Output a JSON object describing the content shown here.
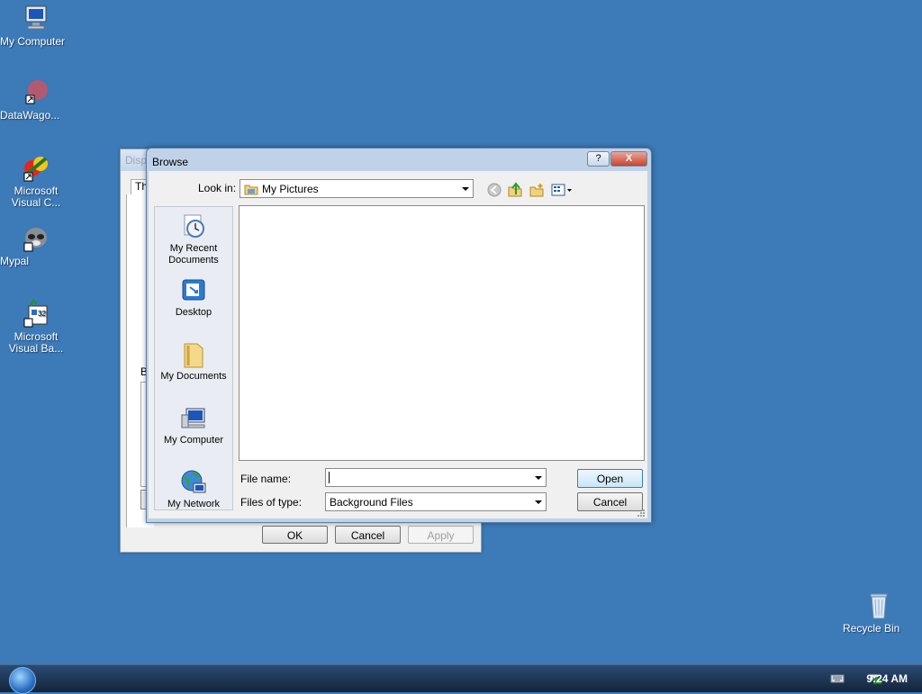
{
  "desktop": {
    "icons": [
      {
        "label": "My Computer",
        "icon": "my-computer-icon"
      },
      {
        "label": "DataWago...",
        "icon": "datawago-shortcut-icon"
      },
      {
        "label": "Microsoft Visual C...",
        "icon": "visual-c-shortcut-icon"
      },
      {
        "label": "Mypal",
        "icon": "mypal-shortcut-icon"
      },
      {
        "label": "Microsoft Visual Ba...",
        "icon": "visual-basic-shortcut-icon"
      },
      {
        "label": "Recycle Bin",
        "icon": "recycle-bin-icon"
      }
    ]
  },
  "background_dialog": {
    "title": "Disp",
    "tab_fragment": "Th",
    "side_letter": "B",
    "ok_label": "OK",
    "cancel_label": "Cancel",
    "apply_label": "Apply"
  },
  "browse": {
    "title": "Browse",
    "help_label": "?",
    "close_label": "X",
    "look_in_label": "Look in:",
    "look_in_value": "My Pictures",
    "places": [
      {
        "label": "My Recent Documents",
        "icon": "recent-documents-icon"
      },
      {
        "label": "Desktop",
        "icon": "desktop-icon"
      },
      {
        "label": "My Documents",
        "icon": "my-documents-folder-icon"
      },
      {
        "label": "My Computer",
        "icon": "my-computer-icon"
      },
      {
        "label": "My Network",
        "icon": "my-network-icon"
      }
    ],
    "file_name_label": "File name:",
    "file_name_value": "",
    "files_of_type_label": "Files of type:",
    "files_of_type_value": "Background Files",
    "open_label": "Open",
    "cancel_label": "Cancel"
  },
  "taskbar": {
    "clock": "9:24 AM"
  }
}
